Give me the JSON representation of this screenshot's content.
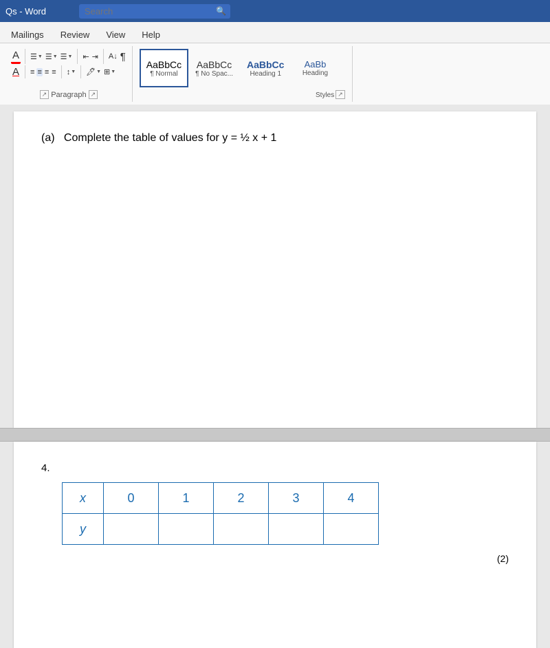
{
  "titleBar": {
    "appName": "Qs - Word",
    "searchPlaceholder": "Search"
  },
  "ribbon": {
    "tabs": [
      "Mailings",
      "Review",
      "View",
      "Help"
    ],
    "paragraphLabel": "Paragraph",
    "stylesLabel": "Styles",
    "styles": [
      {
        "id": "normal",
        "preview": "AaBbCc",
        "name": "¶ Normal",
        "active": true
      },
      {
        "id": "no-spac",
        "preview": "AaBbCc",
        "name": "¶ No Spac...",
        "active": false
      },
      {
        "id": "heading1",
        "preview": "AaBbCc",
        "name": "Heading 1",
        "active": false
      },
      {
        "id": "heading2",
        "preview": "AaBb",
        "name": "Heading",
        "active": false
      }
    ]
  },
  "document": {
    "page1": {
      "questionLabel": "(a)",
      "questionText": "Complete the table of values for y = ½ x + 1"
    },
    "page2": {
      "questionNumber": "4.",
      "table": {
        "xLabel": "x",
        "yLabel": "y",
        "xValues": [
          "0",
          "1",
          "2",
          "3",
          "4"
        ],
        "yValues": [
          "",
          "",
          "",
          "",
          ""
        ]
      },
      "marks": "(2)"
    }
  }
}
